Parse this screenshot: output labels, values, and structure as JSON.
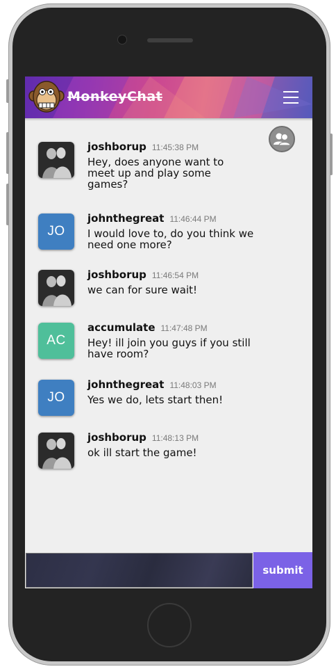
{
  "app": {
    "title": "MonkeyChat"
  },
  "icons": {
    "logo": "monkey-logo",
    "menu": "hamburger-icon",
    "users": "users-icon"
  },
  "colors": {
    "accent": "#7b62e6",
    "jo_avatar": "#3f7fc1",
    "ac_avatar": "#4fbf9a"
  },
  "messages": [
    {
      "user": "joshborup",
      "time": "11:45:38 PM",
      "text": "Hey, does anyone want to meet up and play some games?",
      "avatar": "photo"
    },
    {
      "user": "johnthegreat",
      "time": "11:46:44 PM",
      "text": "I would love to, do you think we need one more?",
      "avatar": "JO"
    },
    {
      "user": "joshborup",
      "time": "11:46:54 PM",
      "text": "we can for sure wait!",
      "avatar": "photo"
    },
    {
      "user": "accumulate",
      "time": "11:47:48 PM",
      "text": "Hey! ill join you guys if you still have room?",
      "avatar": "AC"
    },
    {
      "user": "johnthegreat",
      "time": "11:48:03 PM",
      "text": "Yes we do, lets start then!",
      "avatar": "JO"
    },
    {
      "user": "joshborup",
      "time": "11:48:13 PM",
      "text": "ok ill start the game!",
      "avatar": "photo"
    }
  ],
  "composer": {
    "value": "",
    "placeholder": "",
    "submit_label": "submit"
  }
}
